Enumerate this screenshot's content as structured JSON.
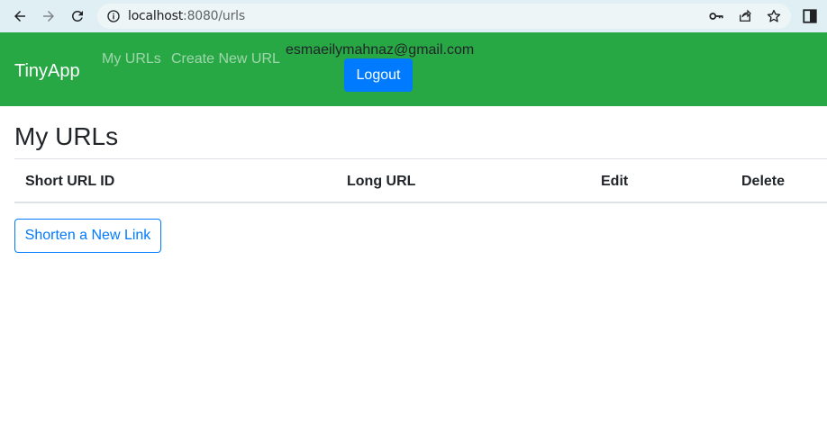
{
  "browser": {
    "url_host": "localhost",
    "url_path": ":8080/urls"
  },
  "navbar": {
    "brand": "TinyApp",
    "links": [
      "My URLs",
      "Create New URL"
    ],
    "email": "esmaeilymahnaz@gmail.com",
    "logout_label": "Logout",
    "color": "#28a745"
  },
  "main": {
    "title": "My URLs",
    "table": {
      "headers": [
        "Short URL ID",
        "Long URL",
        "Edit",
        "Delete"
      ]
    },
    "shorten_button": "Shorten a New Link"
  },
  "colors": {
    "primary": "#007bff",
    "success": "#28a745"
  },
  "icons": [
    "back-arrow-icon",
    "forward-arrow-icon",
    "reload-icon",
    "info-icon",
    "key-icon",
    "share-icon",
    "star-icon",
    "side-panel-icon"
  ]
}
